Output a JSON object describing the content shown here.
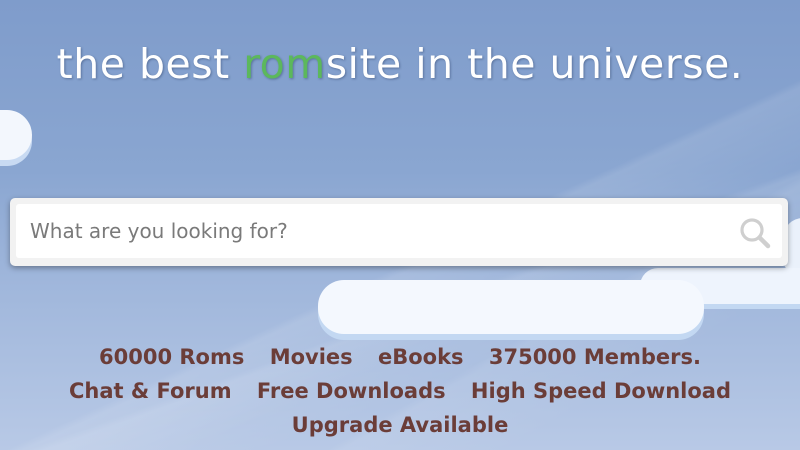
{
  "headline": {
    "prefix": "the best ",
    "accent": "rom",
    "suffix": "site in the universe.",
    "accent_color": "#5cb85c"
  },
  "search": {
    "placeholder": "What are you looking for?",
    "value": "",
    "icon": "search-icon"
  },
  "features": {
    "row1": [
      "60000 Roms",
      "Movies",
      "eBooks",
      "375000 Members."
    ],
    "row2": [
      "Chat & Forum",
      "Free Downloads",
      "High Speed Download"
    ],
    "row3": [
      "Upgrade Available"
    ],
    "text_color": "#6b3d38"
  }
}
